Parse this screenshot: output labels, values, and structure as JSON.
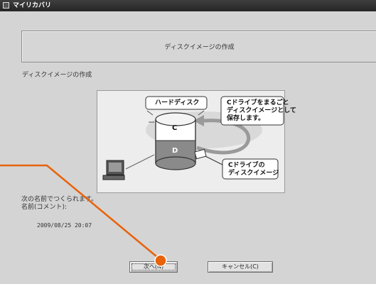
{
  "window": {
    "title": "マイリカバリ"
  },
  "header": {
    "title": "ディスクイメージの作成"
  },
  "section_label": "ディスクイメージの作成",
  "diagram": {
    "hdd_label": "ハードディスク",
    "drive_c": "C",
    "drive_d": "D",
    "callout_save": [
      "Cドライブをまるごと",
      "ディスクイメージとして",
      "保存します。"
    ],
    "callout_image": [
      "Cドライブの",
      "ディスクイメージ"
    ]
  },
  "status": {
    "line1": "次の名前でつくられます。",
    "line2": "名前(コメント):",
    "date": "2009/08/25 20:07"
  },
  "buttons": {
    "next": "次へ(N)",
    "cancel": "キャンセル(C)"
  },
  "colors": {
    "accent": "#e8620a",
    "titlebar": "#2e2e2e",
    "window": "#d4d4d4"
  }
}
